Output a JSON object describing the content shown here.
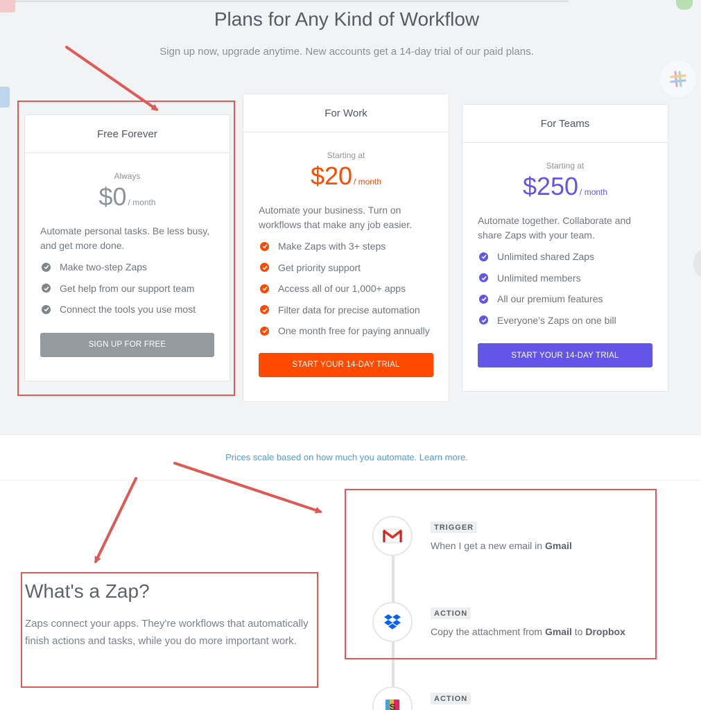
{
  "page": {
    "heading": "Plans for Any Kind of Workflow",
    "subheading": "Sign up now, upgrade anytime. New accounts get a 14-day trial of our paid plans."
  },
  "plans": {
    "free": {
      "name": "Free Forever",
      "price_label": "Always",
      "price": "$0",
      "unit": "/ month",
      "description": "Automate personal tasks. Be less busy, and get more done.",
      "features": [
        "Make two-step Zaps",
        "Get help from our support team",
        "Connect the tools you use most"
      ],
      "cta": "SIGN UP FOR FREE",
      "accent": "#8d9397",
      "button_color": "#959a9e"
    },
    "work": {
      "name": "For Work",
      "price_label": "Starting at",
      "price": "$20",
      "unit": "/ month",
      "description": "Automate your business. Turn on workflows that make any job easier.",
      "features": [
        "Make Zaps with 3+ steps",
        "Get priority support",
        "Access all of our 1,000+ apps",
        "Filter data for precise automation",
        "One month free for paying annually"
      ],
      "cta": "START YOUR 14-DAY TRIAL",
      "accent": "#ff4a00",
      "button_color": "#ff4a00"
    },
    "teams": {
      "name": "For Teams",
      "price_label": "Starting at",
      "price": "$250",
      "unit": "/ month",
      "description": "Automate together. Collaborate and share Zaps with your team.",
      "features": [
        "Unlimited shared Zaps",
        "Unlimited members",
        "All our premium features",
        "Everyone’s Zaps on one bill"
      ],
      "cta": "START YOUR 14-DAY TRIAL",
      "accent": "#6356e6",
      "button_color": "#6356e6"
    }
  },
  "prices_note": "Prices scale based on how much you automate. Learn more.",
  "zap": {
    "title": "What's a Zap?",
    "description": "Zaps connect your apps. They're workflows that automatically finish actions and tasks, while you do more important work."
  },
  "workflow": {
    "steps": [
      {
        "tag": "TRIGGER",
        "text_pre": "When I get a new email in ",
        "app": "Gmail",
        "text_mid": "",
        "app2": "",
        "icon": "gmail-icon"
      },
      {
        "tag": "ACTION",
        "text_pre": "Copy the attachment from ",
        "app": "Gmail",
        "text_mid": " to ",
        "app2": "Dropbox",
        "icon": "dropbox-icon"
      },
      {
        "tag": "ACTION",
        "icon": "slack-icon"
      }
    ]
  },
  "annotation_color": "#e05a55"
}
